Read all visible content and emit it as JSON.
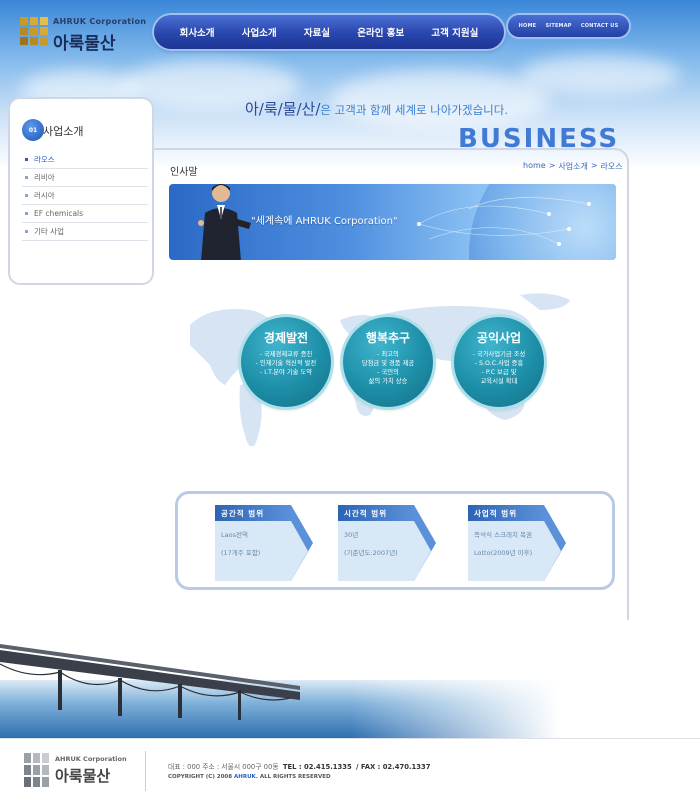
{
  "header": {
    "logo_en": "AHRUK Corporation",
    "logo_ko": "아룩물산",
    "nav": [
      "회사소개",
      "사업소개",
      "자료실",
      "온라인 홍보",
      "고객 지원실"
    ],
    "util": [
      "HOME",
      "SITEMAP",
      "CONTACT US"
    ]
  },
  "hero": {
    "slogan_brand": "아/룩/물/산/",
    "slogan_rest": "은 고객과 함께 세계로 나아가겠습니다.",
    "business": "BUSINESS"
  },
  "sidebar": {
    "badge": "01",
    "title": "사업소개",
    "items": [
      "라오스",
      "리비아",
      "러시아",
      "EF chemicals",
      "기타 사업"
    ]
  },
  "main": {
    "page_title": "인사말",
    "breadcrumb": [
      "home",
      ">",
      "사업소개",
      ">",
      "라오스"
    ],
    "banner_text": "\"세계속에 AHRUK Corporation\"",
    "circles": [
      {
        "title": "경제발전",
        "lines": [
          "- 국제경제교류 증진",
          "- 인재기술 혁신적 발전",
          "- I.T.분야 기술 도약"
        ]
      },
      {
        "title": "행복추구",
        "lines": [
          "- 최고의",
          "당첨금 및 경품 제공",
          "- 국민의",
          "삶의 가치 상승"
        ]
      },
      {
        "title": "공익사업",
        "lines": [
          "- 국가사업기금 조성",
          "- S.O.C.사업 증흥",
          "- P.C 보급 및",
          "교육시설 확대"
        ]
      }
    ],
    "scopes": [
      {
        "head": "공간적 범위",
        "line1": "Laos전역",
        "line2": "(17개주 포함)"
      },
      {
        "head": "시간적 범위",
        "line1": "30년",
        "line2": "(기준년도:2007년)"
      },
      {
        "head": "사업적 범위",
        "line1": "즉석식 스크래치 복권",
        "line2": "Lotto(2009년 이후)"
      }
    ]
  },
  "footer": {
    "logo_en": "AHRUK Corporation",
    "logo_ko": "아룩물산",
    "info_pre": "대표 : 000  주소 : 서울시 000구 00동",
    "tel": "TEL : 02.415.1335",
    "fax": "/  FAX : 02.470.1337",
    "copy_pre": "COPYRIGHT (C) 2008",
    "copy_brand": "AHRUK.",
    "copy_post": "ALL RIGHTS RESERVED"
  },
  "colors": {
    "nav_blue": "#2946ad",
    "accent_blue": "#3f7ad4",
    "circle_teal": "#1d8ea7",
    "logo_gold": "#c89a2c"
  }
}
